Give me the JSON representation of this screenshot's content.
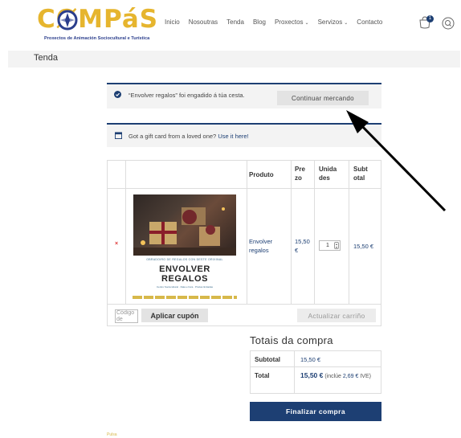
{
  "brand": {
    "name": "CØMPáS",
    "tagline": "Proxectos de Animación Sociocultural e Turística"
  },
  "nav": {
    "items": [
      "Inicio",
      "Nosoutras",
      "Tenda",
      "Blog",
      "Proxectos",
      "Servizos",
      "Contacto"
    ],
    "dropdown_items": [
      "Proxectos",
      "Servizos"
    ],
    "cart_count": "1"
  },
  "page": {
    "title": "Tenda"
  },
  "notices": {
    "added": "“Envolver regalos” foi engadido á túa cesta.",
    "continue_label": "Continuar mercando",
    "gift_text": "Got a gift card from a loved one?",
    "gift_link": "Use it here!"
  },
  "cart": {
    "headers": {
      "product": "Produto",
      "price": "Pre zo",
      "quantity": "Unida des",
      "subtotal": "Subt otal"
    },
    "rows": [
      {
        "remove": "×",
        "image": {
          "caption_top": "OBRADOIRO DE REGALOS CON DESTE ORIXINAL",
          "title_line_1": "ENVOLVER",
          "title_line_2": "REGALOS",
          "caption_bottom": "Centro Sociocultural · Data e hora · Prazas limitadas"
        },
        "product": "Envolver regalos",
        "price": "15,50 €",
        "quantity": "1",
        "subtotal": "15,50 €"
      }
    ],
    "coupon_placeholder": "Código de cupón",
    "apply_coupon": "Aplicar cupón",
    "update_cart": "Actualizar carriño"
  },
  "totals": {
    "title": "Totais da compra",
    "subtotal_label": "Subtotal",
    "subtotal_value": "15,50 €",
    "total_label": "Total",
    "total_value": "15,50 €",
    "tax_prefix": "(inclúe",
    "tax_value": "2,69 €",
    "tax_suffix": "IVE)",
    "checkout": "Finalizar compra"
  },
  "footer": {
    "mark": "Pulsa"
  },
  "colors": {
    "brand_gold": "#e6b52e",
    "brand_blue": "#1d3f73",
    "remove_red": "#dd3333"
  }
}
